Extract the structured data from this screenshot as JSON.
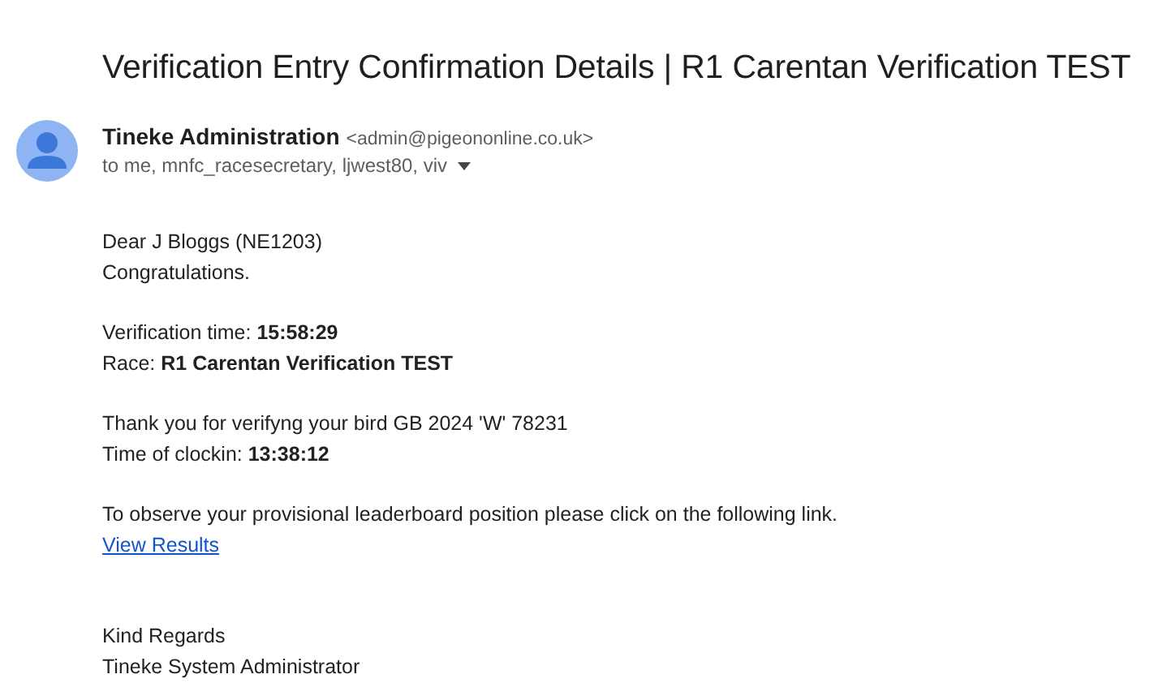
{
  "subject": "Verification Entry Confirmation Details | R1 Carentan Verification TEST",
  "sender": {
    "name": "Tineke Administration",
    "address": "<admin@pigeononline.co.uk>",
    "recipients": "to me, mnfc_racesecretary, ljwest80, viv"
  },
  "body": [
    {
      "kind": "text",
      "lines": [
        {
          "kind": "text",
          "text": "Dear J Bloggs (NE1203)"
        },
        {
          "kind": "text",
          "text": "Congratulations."
        }
      ]
    },
    {
      "kind": "text",
      "lines": [
        {
          "kind": "text",
          "text": "Verification time: **15:58:29**"
        },
        {
          "kind": "text",
          "text": "Race: **R1 Carentan Verification TEST**"
        }
      ]
    },
    {
      "kind": "text",
      "lines": [
        {
          "kind": "text",
          "text": "Thank you for verifyng your bird GB 2024 'W' 78231"
        },
        {
          "kind": "text",
          "text": "Time of clockin: **13:38:12**"
        }
      ]
    },
    {
      "kind": "text",
      "lines": [
        {
          "kind": "text",
          "text": "To observe your provisional leaderboard position please click on the following link."
        },
        {
          "kind": "link",
          "text": "View Results"
        }
      ]
    },
    {
      "kind": "signoff",
      "lines": [
        {
          "kind": "text",
          "text": "Kind Regards"
        },
        {
          "kind": "text",
          "text": "Tineke System Administrator"
        }
      ]
    }
  ]
}
